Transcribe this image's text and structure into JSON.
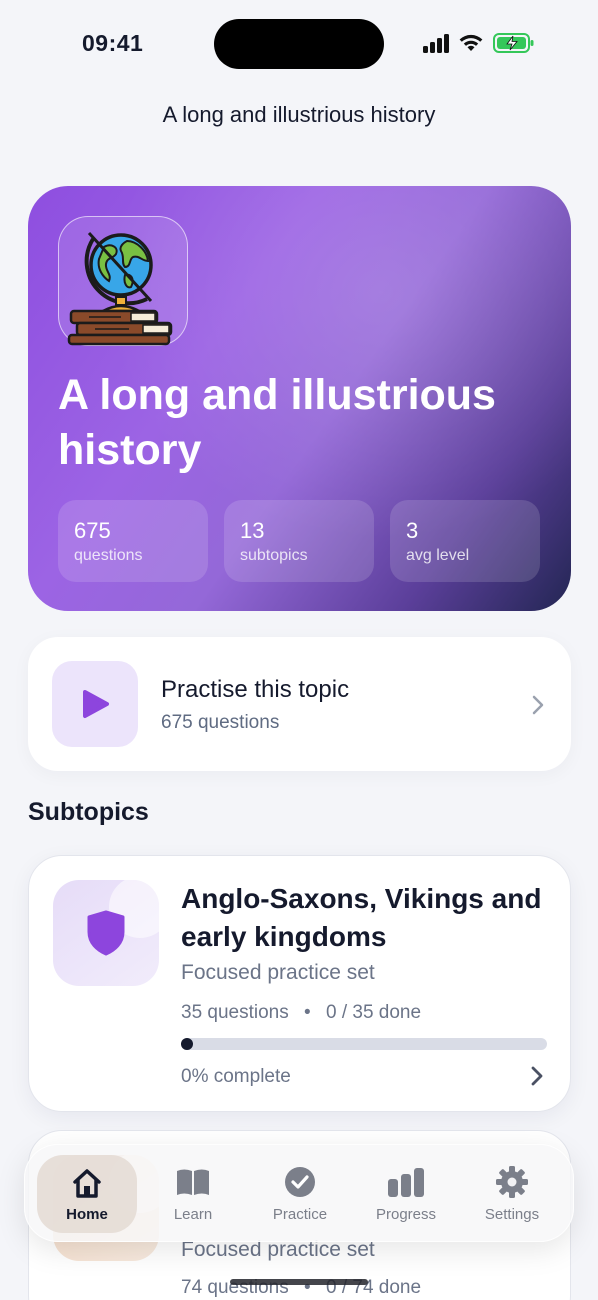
{
  "status_bar": {
    "time": "09:41",
    "battery_color": "#34c759"
  },
  "nav": {
    "title": "A long and illustrious history"
  },
  "hero": {
    "icon": "globe-books-icon",
    "title": "A long and illustrious history",
    "stats": [
      {
        "value": "675",
        "label": "questions"
      },
      {
        "value": "13",
        "label": "subtopics"
      },
      {
        "value": "3",
        "label": "avg level"
      }
    ],
    "gradient_colors": [
      "#8e4ee0",
      "#9c64e4",
      "#232653"
    ]
  },
  "practise": {
    "icon": "play-icon",
    "title": "Practise this topic",
    "subtitle": "675 questions"
  },
  "subtopics": {
    "heading": "Subtopics",
    "items": [
      {
        "icon": "shield-icon",
        "title": "Anglo-Saxons, Vikings and early kingdoms",
        "description": "Focused practice set",
        "questions": "35 questions",
        "separator": "•",
        "done": "0 / 35 done",
        "progress": 0,
        "percent_label": "0% complete"
      },
      {
        "description": "Focused practice set",
        "questions": "74 questions",
        "separator": "•",
        "done": "0 / 74 done",
        "progress": 0
      }
    ]
  },
  "tab_bar": {
    "accent": "#151a2d",
    "tabs": [
      {
        "label": "Home",
        "icon": "home-icon",
        "active": true
      },
      {
        "label": "Learn",
        "icon": "book-icon",
        "active": false
      },
      {
        "label": "Practice",
        "icon": "checkmark-circle-icon",
        "active": false
      },
      {
        "label": "Progress",
        "icon": "bar-chart-icon",
        "active": false
      },
      {
        "label": "Settings",
        "icon": "gear-icon",
        "active": false
      }
    ]
  }
}
